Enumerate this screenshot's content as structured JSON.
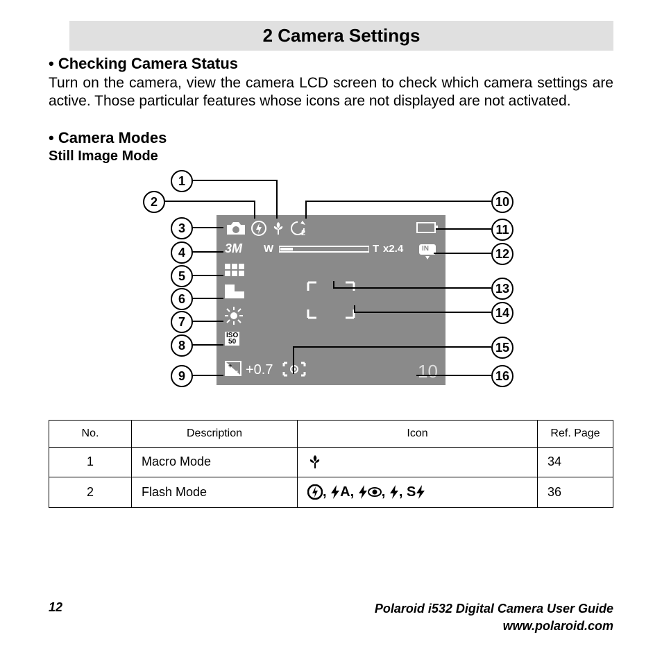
{
  "chapter_title": "2 Camera Settings",
  "section1": {
    "bullet_title": "• Checking Camera Status",
    "text": "Turn on the camera, view the camera LCD screen to check which camera settings are active. Those particular features whose icons are not displayed are not activated."
  },
  "section2": {
    "bullet_title": "•   Camera Modes",
    "mode_label": "Still Image Mode"
  },
  "lcd": {
    "resolution_label": "3M",
    "zoom_w": "W",
    "zoom_t": "T",
    "zoom_value": "x2.4",
    "storage_label": "IN",
    "iso_top": "ISO",
    "iso_value": "50",
    "ev_value": "+0.7",
    "shots_left": "10",
    "self_timer": "2"
  },
  "callouts": [
    "1",
    "2",
    "3",
    "4",
    "5",
    "6",
    "7",
    "8",
    "9",
    "10",
    "11",
    "12",
    "13",
    "14",
    "15",
    "16"
  ],
  "table": {
    "headers": {
      "no": "No.",
      "desc": "Description",
      "icon": "Icon",
      "ref": "Ref. Page"
    },
    "rows": [
      {
        "no": "1",
        "desc": "Macro Mode",
        "icon_labels": [
          "macro"
        ],
        "ref": "34"
      },
      {
        "no": "2",
        "desc": "Flash Mode",
        "icon_labels": [
          "flash-off",
          "flash-auto",
          "flash-redeye",
          "flash-on",
          "flash-slow"
        ],
        "ref": "36"
      }
    ]
  },
  "footer": {
    "page_number": "12",
    "guide_title": "Polaroid i532 Digital Camera User Guide",
    "website": "www.polaroid.com"
  }
}
